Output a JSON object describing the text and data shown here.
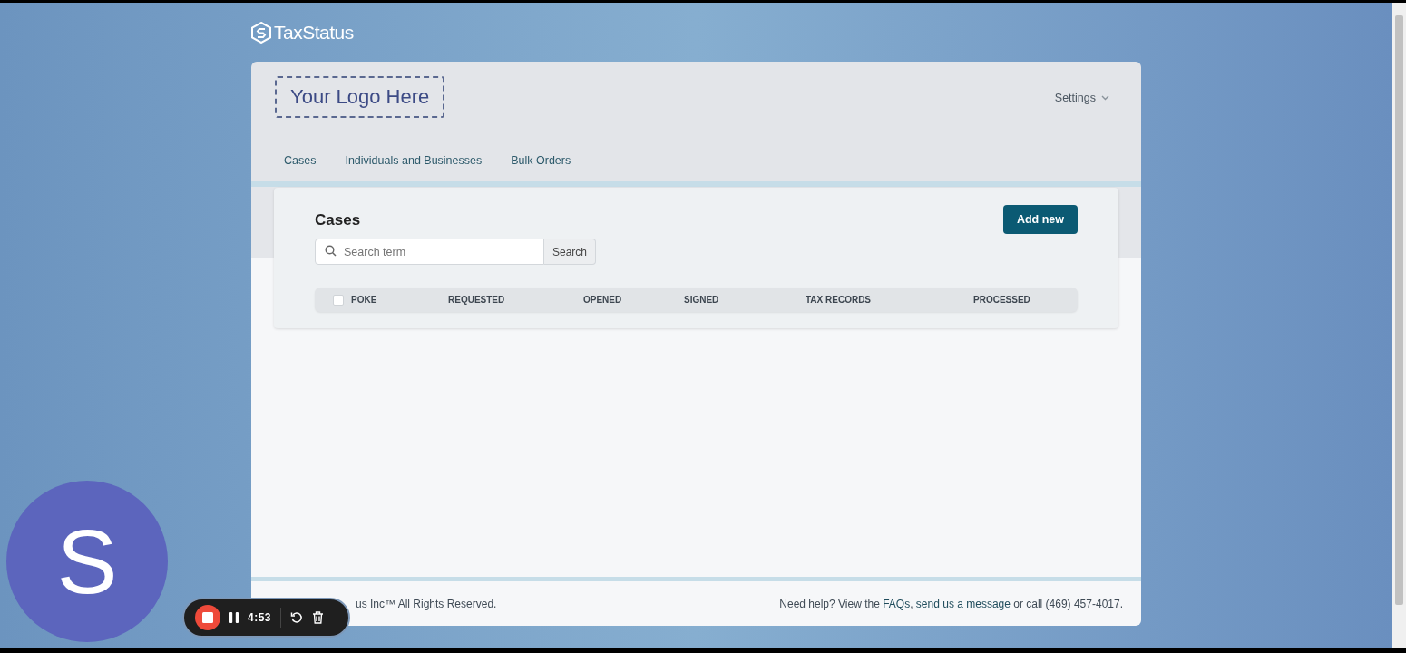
{
  "brand": {
    "name": "TaxStatus"
  },
  "header": {
    "logo_placeholder": "Your Logo Here",
    "settings": "Settings"
  },
  "tabs": [
    {
      "label": "Cases",
      "selected": false
    },
    {
      "label": "Individuals and Businesses",
      "selected": false
    },
    {
      "label": "Bulk Orders",
      "selected": false
    }
  ],
  "panel": {
    "title": "Cases",
    "add_button": "Add new",
    "search": {
      "placeholder": "Search term",
      "button": "Search"
    }
  },
  "table": {
    "select_all": {
      "checked": false
    },
    "columns": [
      "POKE",
      "REQUESTED",
      "OPENED",
      "SIGNED",
      "TAX RECORDS",
      "PROCESSED"
    ]
  },
  "footer": {
    "copyright": "us Inc™ All Rights Reserved.",
    "help_prefix": "Need help?  View the ",
    "faq_link": "FAQs",
    "separator": ", ",
    "message_link": "send us a message",
    "help_suffix": " or call (469) 457-4017."
  },
  "recorder": {
    "avatar_letter": "S",
    "timer": "4:53"
  }
}
